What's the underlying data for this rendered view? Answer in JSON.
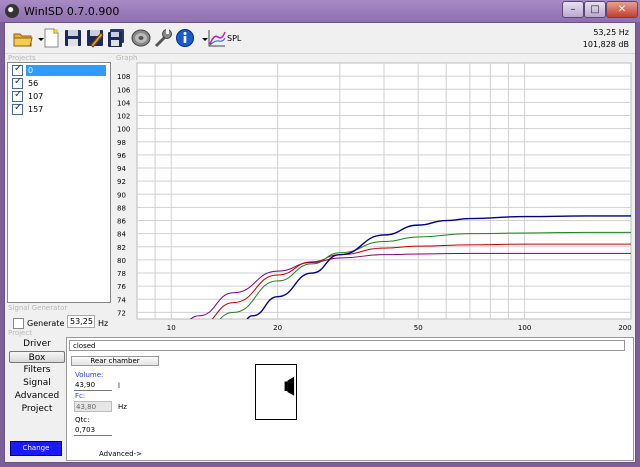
{
  "window": {
    "title": "WinISD 0.7.0.900"
  },
  "toolbar": {
    "icons": [
      "open-folder-icon",
      "chevron-down-icon",
      "new-document-icon",
      "save-icon",
      "save-as-icon",
      "save-all-icon",
      "speaker-driver-icon",
      "wrench-icon",
      "info-icon",
      "chevron-down-icon",
      "graph-icon"
    ],
    "spl_label": "SPL",
    "readout_freq": "53,25 Hz",
    "readout_db": "101,828 dB"
  },
  "sections": {
    "projects": "Projects",
    "graph": "Graph",
    "signal_generator": "Signal Generator",
    "project": "Project"
  },
  "projects": [
    {
      "label": "0",
      "checked": true,
      "selected": true
    },
    {
      "label": "56",
      "checked": true
    },
    {
      "label": "107",
      "checked": true
    },
    {
      "label": "157",
      "checked": true
    }
  ],
  "signal_generator": {
    "label": "Generate",
    "value": "53,25",
    "unit": "Hz"
  },
  "project_tabs": [
    {
      "label": "Driver"
    },
    {
      "label": "Box",
      "active": true
    },
    {
      "label": "Filters"
    },
    {
      "label": "Signal"
    },
    {
      "label": "Advanced"
    },
    {
      "label": "Project"
    }
  ],
  "change_button": "Change",
  "box": {
    "type": "closed",
    "rear_chamber_button": "Rear chamber",
    "volume_label": "Volume:",
    "volume_value": "43,90",
    "volume_unit": "l",
    "fc_label": "Fc:",
    "fc_value": "43,80",
    "fc_unit": "Hz",
    "qtc_label": "Qtc:",
    "qtc_value": "0,703",
    "advanced_link": "Advanced->"
  },
  "chart_data": {
    "type": "line",
    "title": "",
    "xlabel": "",
    "ylabel": "",
    "xscale": "log",
    "xlim": [
      8,
      200
    ],
    "ylim": [
      71,
      110
    ],
    "x_ticks": [
      10,
      20,
      50,
      100,
      200
    ],
    "y_ticks": [
      72,
      74,
      76,
      78,
      80,
      82,
      84,
      86,
      88,
      90,
      92,
      94,
      96,
      98,
      100,
      102,
      104,
      106,
      108
    ],
    "grid": true,
    "legend": "none",
    "series": [
      {
        "color": "#800080",
        "x": [
          10,
          12,
          15,
          20,
          25,
          30,
          40,
          50,
          70,
          100,
          150,
          200
        ],
        "y": [
          68.5,
          71.5,
          75.0,
          78.3,
          79.6,
          80.3,
          80.8,
          80.9,
          81.0,
          81.0,
          81.0,
          81.0
        ]
      },
      {
        "color": "#c00000",
        "x": [
          10,
          12,
          15,
          20,
          25,
          30,
          40,
          50,
          70,
          100,
          150,
          200
        ],
        "y": [
          67.0,
          70.0,
          73.5,
          77.7,
          79.7,
          80.8,
          81.8,
          82.1,
          82.3,
          82.4,
          82.4,
          82.4
        ]
      },
      {
        "color": "#208020",
        "x": [
          10,
          12,
          15,
          20,
          25,
          30,
          40,
          50,
          70,
          100,
          150,
          200
        ],
        "y": [
          65.5,
          68.5,
          72.0,
          76.8,
          79.4,
          81.1,
          82.8,
          83.5,
          84.0,
          84.1,
          84.2,
          84.2
        ]
      },
      {
        "color": "#000080",
        "x": [
          15,
          17,
          20,
          25,
          30,
          40,
          50,
          60,
          70,
          100,
          150,
          200
        ],
        "y": [
          68.0,
          71.5,
          74.4,
          78.0,
          80.8,
          83.8,
          85.3,
          86.0,
          86.3,
          86.6,
          86.7,
          86.7
        ]
      }
    ]
  }
}
